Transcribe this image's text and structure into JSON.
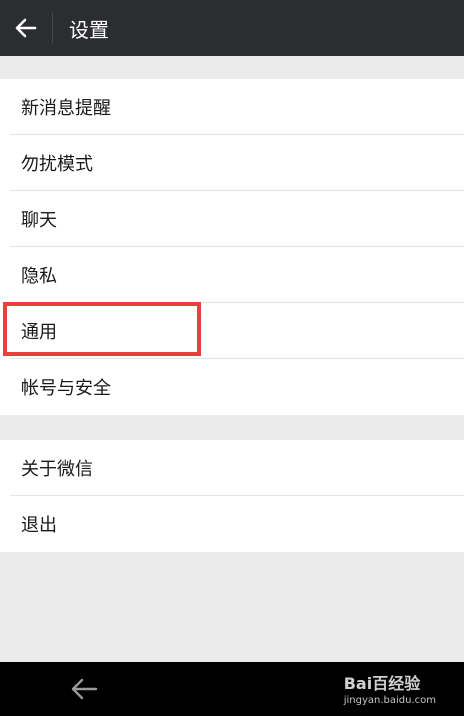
{
  "header": {
    "title": "设置"
  },
  "settings": {
    "group1": [
      {
        "label": "新消息提醒"
      },
      {
        "label": "勿扰模式"
      },
      {
        "label": "聊天"
      },
      {
        "label": "隐私"
      },
      {
        "label": "通用"
      },
      {
        "label": "帐号与安全"
      }
    ],
    "group2": [
      {
        "label": "关于微信"
      },
      {
        "label": "退出"
      }
    ]
  },
  "watermark": {
    "logo_text": "Bai百经验",
    "url": "jingyan.baidu.com"
  },
  "colors": {
    "topbar": "#2b2d31",
    "highlight": "#e8413d",
    "background": "#ebebeb"
  }
}
